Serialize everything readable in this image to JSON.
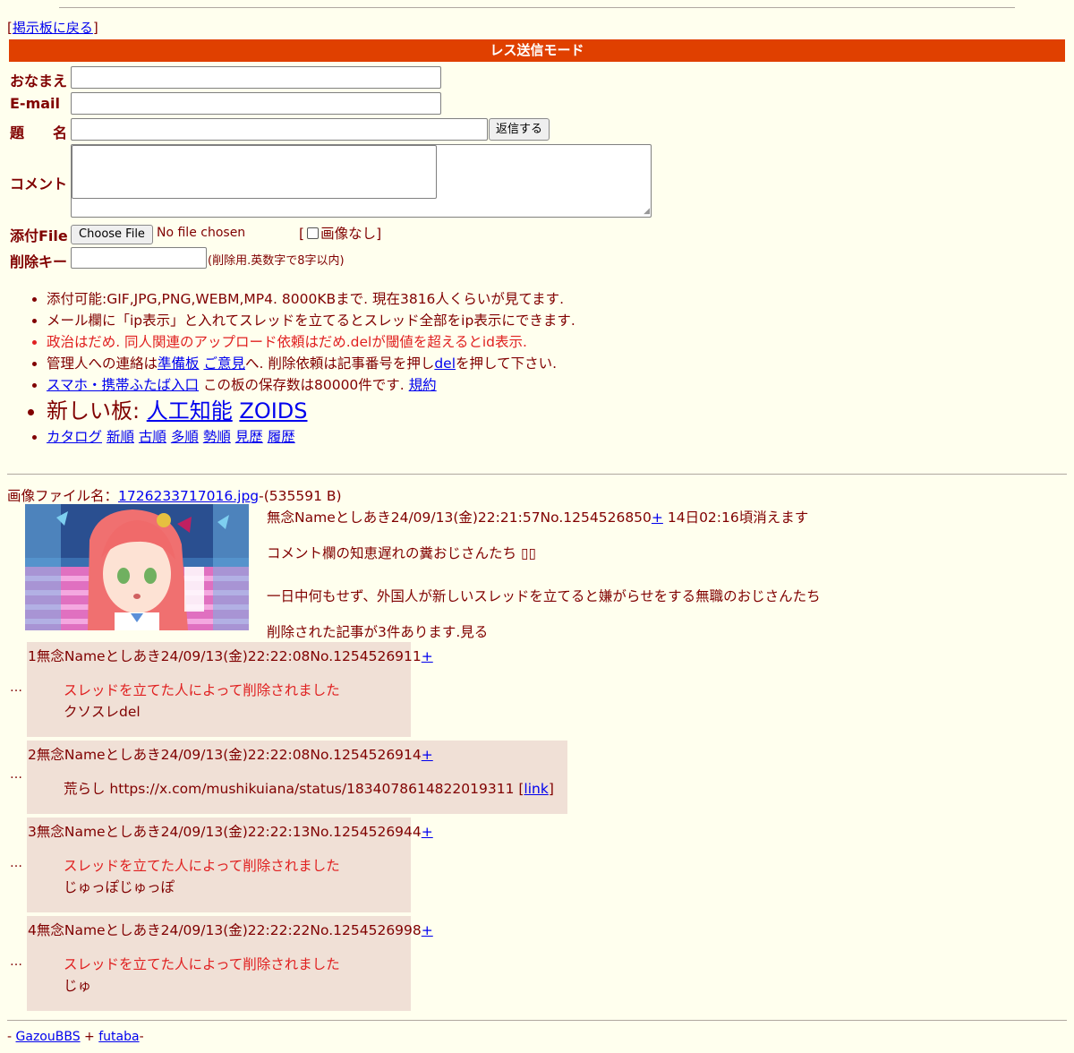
{
  "nav": {
    "back_link": "掲示板に戻る"
  },
  "form": {
    "mode_title": "レス送信モード",
    "name_label": "おなまえ",
    "email_label": "E-mail",
    "subject_label": "題　　名",
    "submit_label": "返信する",
    "comment_label": "コメント",
    "file_label": "添付File",
    "file_button": "Choose File",
    "file_status": "No file chosen",
    "no_image_label": "画像なし",
    "delkey_label": "削除キー",
    "delkey_hint": "(削除用.英数字で8字以内)"
  },
  "notes": {
    "line1": "添付可能:GIF,JPG,PNG,WEBM,MP4. 8000KBまで. 現在3816人くらいが見てます.",
    "line2": "メール欄に「ip表示」と入れてスレッドを立てるとスレッド全部をip表示にできます.",
    "line3": "政治はだめ. 同人関連のアップロード依頼はだめ.delが閾値を超えるとid表示.",
    "line4_a": "管理人への連絡は",
    "line4_link1": "準備板",
    "line4_link2": "ご意見",
    "line4_b": "へ. 削除依頼は記事番号を押し",
    "line4_link3": "del",
    "line4_c": "を押して下さい.",
    "line5_link": "スマホ・携帯ふたば入口",
    "line5_text": "この板の保存数は80000件です.",
    "line5_link2": "規約",
    "line6_text": "新しい板:",
    "line6_link1": "人工知能",
    "line6_link2": "ZOIDS",
    "catalog_links": [
      "カタログ",
      "新順",
      "古順",
      "多順",
      "勢順",
      "見歴",
      "履歴"
    ]
  },
  "thread": {
    "file_label": "画像ファイル名：",
    "file_name": "1726233717016.jpg",
    "file_size": "-(535591 B)",
    "op_header": "無念Nameとしあき24/09/13(金)22:21:57No.1254526850",
    "op_plus": "+",
    "op_expire": "14日02:16頃消えます",
    "op_line1": "コメント欄の知恵遅れの糞おじさんたち",
    "op_line1_glyphs": "▯▯",
    "op_line2": "一日中何もせず、外国人が新しいスレッドを立てると嫌がらせをする無職のおじさんたち",
    "deleted_notice": "削除された記事が3件あります.見る",
    "ellipsis": "…",
    "replies": [
      {
        "header": "1無念Nameとしあき24/09/13(金)22:22:08No.1254526911",
        "plus": "+",
        "deleted": "スレッドを立てた人によって削除されました",
        "text": "クソスレdel"
      },
      {
        "header": "2無念Nameとしあき24/09/13(金)22:22:08No.1254526914",
        "plus": "+",
        "text": "荒らし https://x.com/mushikuiana/status/1834078614822019311 ",
        "link": "link"
      },
      {
        "header": "3無念Nameとしあき24/09/13(金)22:22:13No.1254526944",
        "plus": "+",
        "deleted": "スレッドを立てた人によって削除されました",
        "text": "じゅっぽじゅっぽ"
      },
      {
        "header": "4無念Nameとしあき24/09/13(金)22:22:22No.1254526998",
        "plus": "+",
        "deleted": "スレッドを立てた人によって削除されました",
        "text": "じゅ"
      }
    ]
  },
  "footer": {
    "prefix": "- ",
    "link1": "GazouBBS",
    "sep": " + ",
    "link2": "futaba",
    "suffix": "-"
  },
  "colors": {
    "background": "#ffffee",
    "text": "#800000",
    "header_bar": "#e04000",
    "reply_bg": "#f0e0d6",
    "link": "#0000ee",
    "deleted": "#e02020"
  }
}
